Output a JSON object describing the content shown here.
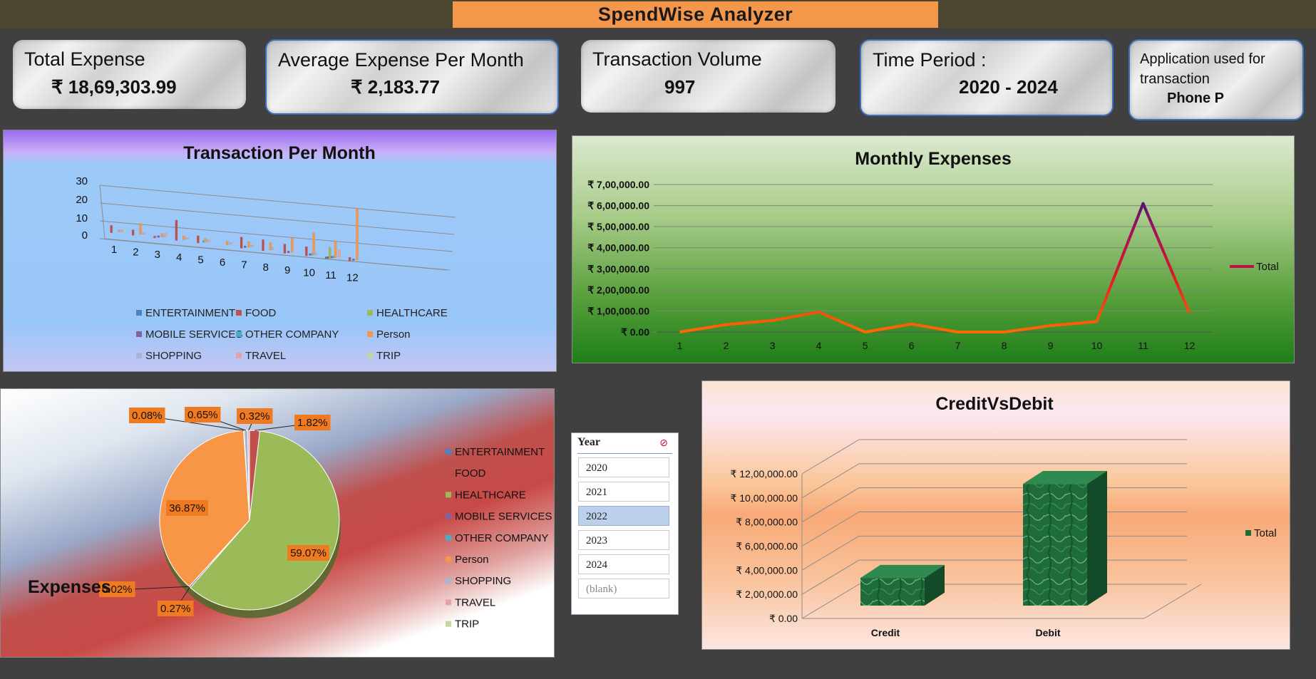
{
  "app": {
    "title": "SpendWise Analyzer"
  },
  "kpis": {
    "total_expense": {
      "label": "Total Expense",
      "value": "₹ 18,69,303.99"
    },
    "avg_expense": {
      "label": "Average Expense Per Month",
      "value": "₹ 2,183.77"
    },
    "volume": {
      "label": "Transaction Volume",
      "value": "997"
    },
    "period": {
      "label": "Time Period :",
      "value": "2020 - 2024"
    },
    "app_used": {
      "label": "Application used for transaction",
      "value": "Phone P"
    }
  },
  "categories": [
    "ENTERTAINMENT",
    "FOOD",
    "HEALTHCARE",
    "MOBILE SERVICES",
    "OTHER COMPANY",
    "Person",
    "SHOPPING",
    "TRAVEL",
    "TRIP"
  ],
  "category_colors": [
    "#4f81bd",
    "#c0504d",
    "#9bbb59",
    "#8064a2",
    "#4bacc6",
    "#f79646",
    "#a5b6d6",
    "#e6a3a1",
    "#c3d69b"
  ],
  "slicer": {
    "header": "Year",
    "items": [
      {
        "label": "2020",
        "selected": false
      },
      {
        "label": "2021",
        "selected": false
      },
      {
        "label": "2022",
        "selected": true
      },
      {
        "label": "2023",
        "selected": false
      },
      {
        "label": "2024",
        "selected": false
      },
      {
        "label": "(blank)",
        "selected": false
      }
    ]
  },
  "chart_data": [
    {
      "type": "bar",
      "title": "Transaction Per Month",
      "categories": [
        "1",
        "2",
        "3",
        "4",
        "5",
        "6",
        "7",
        "8",
        "9",
        "10",
        "11",
        "12"
      ],
      "ylim": [
        0,
        30
      ],
      "yticks": [
        "0",
        "10",
        "20",
        "30"
      ],
      "series": [
        {
          "name": "ENTERTAINMENT",
          "values": [
            0,
            0,
            0,
            0,
            0,
            0,
            0,
            0,
            0,
            0,
            1,
            0
          ]
        },
        {
          "name": "FOOD",
          "values": [
            4,
            3,
            1,
            11,
            4,
            0,
            6,
            6,
            5,
            5,
            1,
            2
          ]
        },
        {
          "name": "HEALTHCARE",
          "values": [
            0,
            0,
            0,
            0,
            0,
            0,
            0,
            0,
            0,
            0,
            6,
            0
          ]
        },
        {
          "name": "MOBILE SERVICES",
          "values": [
            0,
            0,
            1,
            0,
            0,
            0,
            1,
            0,
            1,
            1,
            1,
            1
          ]
        },
        {
          "name": "OTHER COMPANY",
          "values": [
            0,
            0,
            0,
            0,
            1,
            0,
            0,
            0,
            0,
            1,
            1,
            0
          ]
        },
        {
          "name": "Person",
          "values": [
            1,
            6,
            2,
            2,
            2,
            2,
            3,
            4,
            8,
            12,
            9,
            28
          ]
        },
        {
          "name": "SHOPPING",
          "values": [
            1,
            1,
            1,
            1,
            1,
            1,
            1,
            1,
            0,
            1,
            0,
            0
          ]
        },
        {
          "name": "TRAVEL",
          "values": [
            1,
            1,
            2,
            1,
            1,
            1,
            1,
            0,
            0,
            0,
            4,
            0
          ]
        },
        {
          "name": "TRIP",
          "values": [
            1,
            0,
            0,
            0,
            0,
            0,
            0,
            0,
            0,
            0,
            0,
            0
          ]
        }
      ],
      "legend": "bottom",
      "grid": true
    },
    {
      "type": "line",
      "title": "Monthly Expenses",
      "categories": [
        "1",
        "2",
        "3",
        "4",
        "5",
        "6",
        "7",
        "8",
        "9",
        "10",
        "11",
        "12"
      ],
      "ylim": [
        0,
        700000
      ],
      "yticks": [
        "₹ 0.00",
        "₹ 1,00,000.00",
        "₹ 2,00,000.00",
        "₹ 3,00,000.00",
        "₹ 4,00,000.00",
        "₹ 5,00,000.00",
        "₹ 6,00,000.00",
        "₹ 7,00,000.00"
      ],
      "series": [
        {
          "name": "Total",
          "values": [
            0,
            35000,
            55000,
            95000,
            0,
            38000,
            0,
            0,
            30000,
            50000,
            610000,
            90000
          ]
        }
      ],
      "legend": "right",
      "grid": true
    },
    {
      "type": "pie",
      "title": "Expenses",
      "categories": [
        "ENTERTAINMENT",
        "FOOD",
        "HEALTHCARE",
        "MOBILE SERVICES",
        "OTHER COMPANY",
        "Person",
        "SHOPPING",
        "TRAVEL",
        "TRIP"
      ],
      "values": [
        0.08,
        1.82,
        59.07,
        0.27,
        0.02,
        36.87,
        0.65,
        0.32,
        0.0
      ],
      "data_labels": [
        "0.08%",
        "1.82%",
        "59.07%",
        "0.27%",
        "0.02%",
        "36.87%",
        "0.65%",
        "0.32%",
        ""
      ],
      "legend": "right"
    },
    {
      "type": "bar",
      "title": "CreditVsDebit",
      "categories": [
        "Credit",
        "Debit"
      ],
      "ylim": [
        0,
        1200000
      ],
      "yticks": [
        "₹ 0.00",
        "₹ 2,00,000.00",
        "₹ 4,00,000.00",
        "₹ 6,00,000.00",
        "₹ 8,00,000.00",
        "₹ 10,00,000.00",
        "₹ 12,00,000.00"
      ],
      "series": [
        {
          "name": "Total",
          "values": [
            230000,
            1010000
          ]
        }
      ],
      "legend": "right",
      "grid": true
    }
  ]
}
